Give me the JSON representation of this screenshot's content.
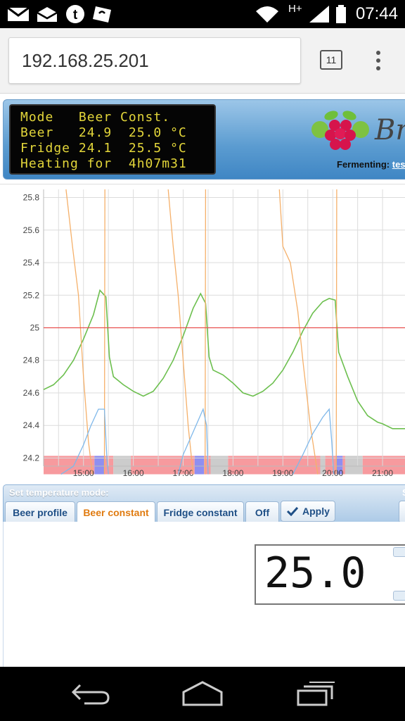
{
  "status_bar": {
    "time": "07:44",
    "network_type": "H+",
    "icons": [
      "gmail-icon",
      "mail-icon",
      "tumblr-icon",
      "store-icon",
      "wifi-icon",
      "signal-icon",
      "battery-icon"
    ]
  },
  "browser": {
    "url": "192.168.25.201",
    "tab_count": "11",
    "menu_icon": "overflow-menu-icon"
  },
  "lcd": {
    "lines": [
      "Mode   Beer Const.",
      "Beer   24.9  25.0 °C",
      "Fridge 24.1  25.5 °C",
      "Heating for  4h07m31"
    ]
  },
  "header": {
    "brand_partial": "Br",
    "fermenting_label": "Fermenting:",
    "fermenting_link": "test"
  },
  "chart_data": {
    "type": "line",
    "y_ticks": [
      "25.8",
      "25.6",
      "25.4",
      "25.2",
      "25",
      "24.8",
      "24.6",
      "24.4",
      "24.2"
    ],
    "x_ticks": [
      "15:00",
      "16:00",
      "17:00",
      "18:00",
      "19:00",
      "20:00",
      "21:00"
    ],
    "ylim": [
      24.15,
      25.85
    ],
    "xlim": [
      14.2,
      21.45
    ],
    "beer_setting": 25.0,
    "colors": {
      "beer_temp": "#6cbf4e",
      "fridge_temp": "#f5b06a",
      "fridge_setting": "#7fb8ea",
      "beer_setting": "#e8504f",
      "state_heating": "#f79a9e",
      "state_cooling": "#8f8ff0",
      "state_idle": "#cccccc"
    },
    "series": [
      {
        "key": "beer_temp",
        "points": [
          [
            14.2,
            24.62
          ],
          [
            14.4,
            24.65
          ],
          [
            14.6,
            24.71
          ],
          [
            14.8,
            24.8
          ],
          [
            15.0,
            24.93
          ],
          [
            15.2,
            25.08
          ],
          [
            15.33,
            25.23
          ],
          [
            15.45,
            25.19
          ],
          [
            15.52,
            24.82
          ],
          [
            15.6,
            24.7
          ],
          [
            15.8,
            24.65
          ],
          [
            16.0,
            24.61
          ],
          [
            16.2,
            24.58
          ],
          [
            16.4,
            24.61
          ],
          [
            16.6,
            24.69
          ],
          [
            16.8,
            24.8
          ],
          [
            17.0,
            24.95
          ],
          [
            17.2,
            25.12
          ],
          [
            17.35,
            25.21
          ],
          [
            17.45,
            25.15
          ],
          [
            17.52,
            24.82
          ],
          [
            17.6,
            24.74
          ],
          [
            17.8,
            24.71
          ],
          [
            18.0,
            24.66
          ],
          [
            18.2,
            24.6
          ],
          [
            18.4,
            24.58
          ],
          [
            18.6,
            24.61
          ],
          [
            18.8,
            24.66
          ],
          [
            19.0,
            24.74
          ],
          [
            19.2,
            24.85
          ],
          [
            19.4,
            24.98
          ],
          [
            19.6,
            25.09
          ],
          [
            19.8,
            25.16
          ],
          [
            19.93,
            25.18
          ],
          [
            20.05,
            25.17
          ],
          [
            20.12,
            24.85
          ],
          [
            20.3,
            24.7
          ],
          [
            20.5,
            24.55
          ],
          [
            20.7,
            24.46
          ],
          [
            20.9,
            24.42
          ],
          [
            21.0,
            24.41
          ],
          [
            21.2,
            24.38
          ],
          [
            21.45,
            24.38
          ]
        ]
      },
      {
        "key": "fridge_temp",
        "points": [
          [
            14.65,
            25.85
          ],
          [
            14.78,
            25.5
          ],
          [
            14.9,
            25.2
          ],
          [
            15.0,
            24.7
          ],
          [
            15.1,
            24.3
          ],
          [
            15.18,
            24.1
          ]
        ],
        "segments": [
          [
            [
              15.42,
              24.1
            ],
            [
              15.43,
              25.85
            ]
          ],
          [
            [
              16.7,
              25.85
            ],
            [
              16.8,
              25.5
            ],
            [
              16.9,
              25.2
            ],
            [
              17.0,
              24.8
            ],
            [
              17.1,
              24.4
            ],
            [
              17.2,
              24.1
            ]
          ],
          [
            [
              17.44,
              24.1
            ],
            [
              17.45,
              25.85
            ]
          ],
          [
            [
              18.93,
              25.85
            ],
            [
              19.0,
              25.5
            ],
            [
              19.15,
              25.4
            ],
            [
              19.3,
              25.1
            ],
            [
              19.4,
              24.8
            ],
            [
              19.55,
              24.4
            ],
            [
              19.7,
              24.1
            ]
          ],
          [
            [
              20.07,
              24.1
            ],
            [
              20.08,
              25.85
            ]
          ]
        ]
      },
      {
        "key": "fridge_setting",
        "points": [
          [
            14.55,
            24.1
          ],
          [
            14.8,
            24.15
          ],
          [
            15.0,
            24.28
          ],
          [
            15.15,
            24.4
          ],
          [
            15.3,
            24.5
          ],
          [
            15.42,
            24.5
          ],
          [
            15.47,
            24.2
          ],
          [
            15.5,
            24.1
          ]
        ],
        "segments": [
          [
            [
              16.9,
              24.1
            ],
            [
              17.0,
              24.22
            ],
            [
              17.2,
              24.36
            ],
            [
              17.4,
              24.5
            ],
            [
              17.47,
              24.4
            ],
            [
              17.5,
              24.1
            ]
          ],
          [
            [
              19.2,
              24.1
            ],
            [
              19.4,
              24.22
            ],
            [
              19.6,
              24.35
            ],
            [
              19.8,
              24.45
            ],
            [
              19.93,
              24.5
            ],
            [
              19.98,
              24.3
            ],
            [
              20.02,
              24.1
            ]
          ]
        ]
      },
      {
        "key": "beer_setting",
        "points": [
          [
            14.2,
            25.0
          ],
          [
            21.45,
            25.0
          ]
        ]
      }
    ],
    "state_bands": [
      {
        "from": 14.2,
        "to": 15.22,
        "state": "heating"
      },
      {
        "from": 15.22,
        "to": 15.42,
        "state": "cooling"
      },
      {
        "from": 15.42,
        "to": 15.6,
        "state": "heating"
      },
      {
        "from": 15.6,
        "to": 15.95,
        "state": "idle"
      },
      {
        "from": 15.95,
        "to": 17.23,
        "state": "heating"
      },
      {
        "from": 17.23,
        "to": 17.42,
        "state": "cooling"
      },
      {
        "from": 17.42,
        "to": 17.55,
        "state": "heating"
      },
      {
        "from": 17.55,
        "to": 17.9,
        "state": "idle"
      },
      {
        "from": 17.9,
        "to": 19.75,
        "state": "heating"
      },
      {
        "from": 19.75,
        "to": 19.85,
        "state": "idle"
      },
      {
        "from": 19.85,
        "to": 20.07,
        "state": "heating"
      },
      {
        "from": 20.07,
        "to": 20.2,
        "state": "cooling"
      },
      {
        "from": 20.2,
        "to": 20.25,
        "state": "heating"
      },
      {
        "from": 20.25,
        "to": 20.6,
        "state": "idle"
      },
      {
        "from": 20.6,
        "to": 21.45,
        "state": "heating"
      }
    ]
  },
  "controls": {
    "title": "Set temperature mode:",
    "right_partial": "S",
    "tabs": [
      "Beer profile",
      "Beer constant",
      "Fridge constant",
      "Off"
    ],
    "active_tab": "Beer constant",
    "apply_label": "Apply",
    "apply_icon": "checkmark-icon",
    "setpoint_value": "25.0"
  },
  "navbar": {
    "icons": [
      "back-icon",
      "home-icon",
      "recent-apps-icon"
    ]
  }
}
